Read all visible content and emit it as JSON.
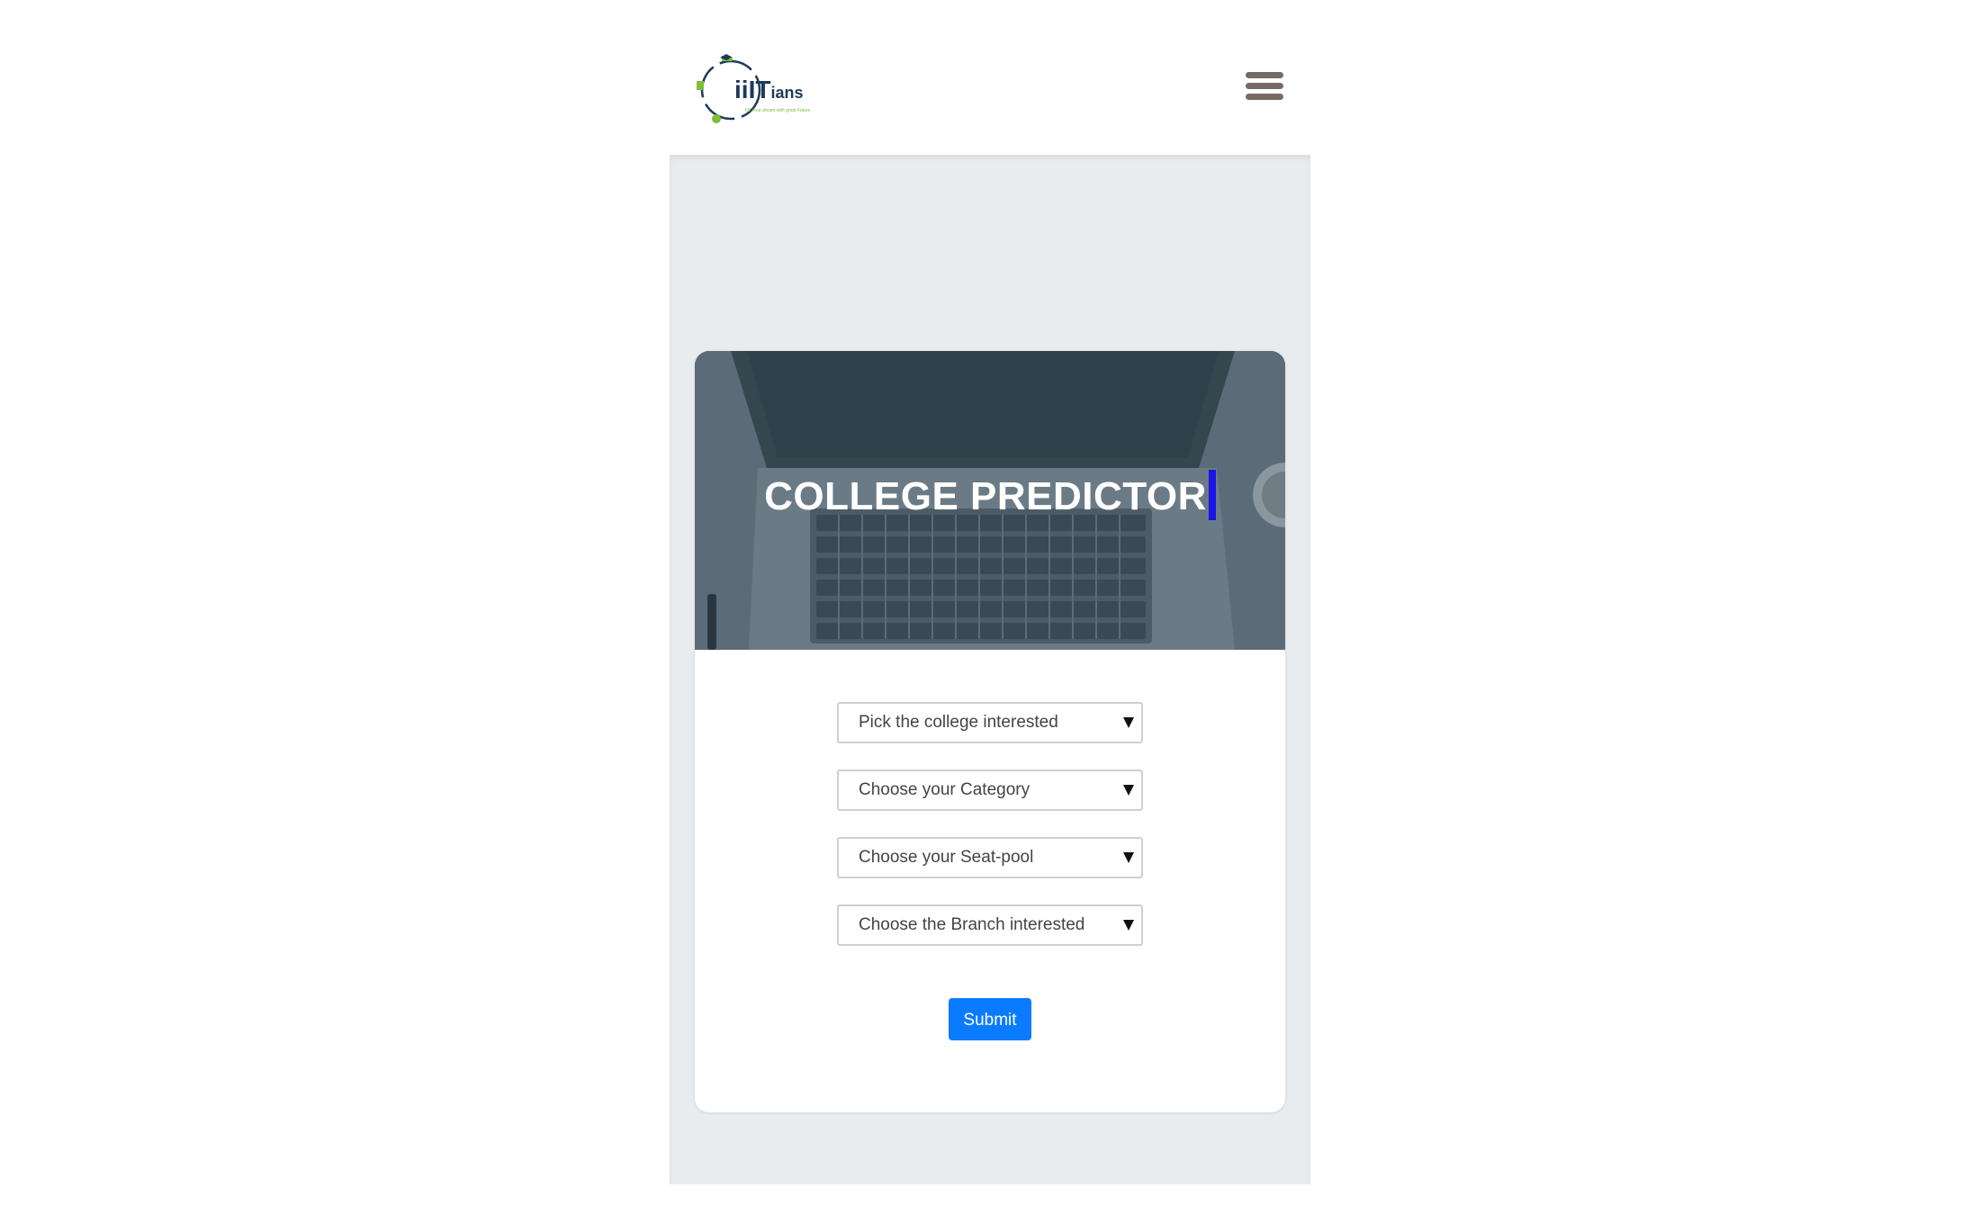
{
  "header": {
    "logo": {
      "text_prefix": "ii",
      "text_main": "IT",
      "text_suffix": "ians",
      "tagline": "Fill Your dream with great Future",
      "accent_colors": [
        "#7cbf3a",
        "#1f3a5a"
      ]
    },
    "menu_icon": "hamburger-menu-icon"
  },
  "hero": {
    "title": "COLLEGE PREDICTOR",
    "background_subject": "laptop-keyboard",
    "overlay_color": "#4e6170"
  },
  "form": {
    "selects": [
      {
        "selected": "Pick the college interested"
      },
      {
        "selected": "Choose your Category"
      },
      {
        "selected": "Choose your Seat-pool"
      },
      {
        "selected": "Choose the Branch interested"
      }
    ],
    "submit_label": "Submit"
  },
  "colors": {
    "primary_button": "#0a7bff",
    "caret": "#1a14e8",
    "page_gray": "#e9ecee",
    "menu_icon": "#776a64"
  }
}
